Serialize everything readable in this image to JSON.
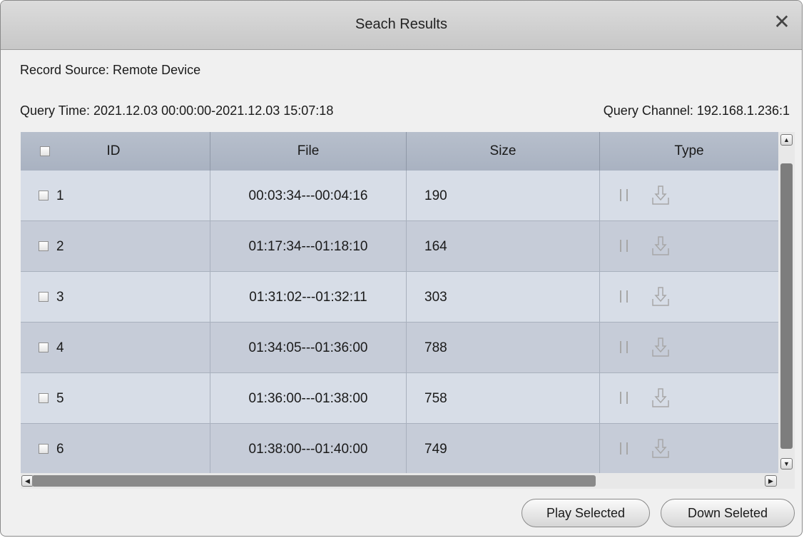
{
  "dialog": {
    "title": "Seach Results",
    "close_glyph": "✕"
  },
  "info": {
    "record_source": "Record Source:  Remote Device",
    "query_time": "Query Time:  2021.12.03 00:00:00-2021.12.03 15:07:18",
    "query_channel": "Query Channel:  192.168.1.236:1"
  },
  "table": {
    "columns": [
      "ID",
      "File",
      "Size",
      "Type"
    ],
    "rows": [
      {
        "id": "1",
        "file": "00:03:34---00:04:16",
        "size": "190"
      },
      {
        "id": "2",
        "file": "01:17:34---01:18:10",
        "size": "164"
      },
      {
        "id": "3",
        "file": "01:31:02---01:32:11",
        "size": "303"
      },
      {
        "id": "4",
        "file": "01:34:05---01:36:00",
        "size": "788"
      },
      {
        "id": "5",
        "file": "01:36:00---01:38:00",
        "size": "758"
      },
      {
        "id": "6",
        "file": "01:38:00---01:40:00",
        "size": "749"
      }
    ],
    "row_icons": [
      "pause-icon",
      "download-icon"
    ]
  },
  "buttons": {
    "play_selected": "Play Selected",
    "down_selected": "Down Seleted"
  },
  "colors": {
    "header": "#b0b8c6",
    "row_odd": "#d7dde7",
    "row_even": "#c6ccd8"
  }
}
